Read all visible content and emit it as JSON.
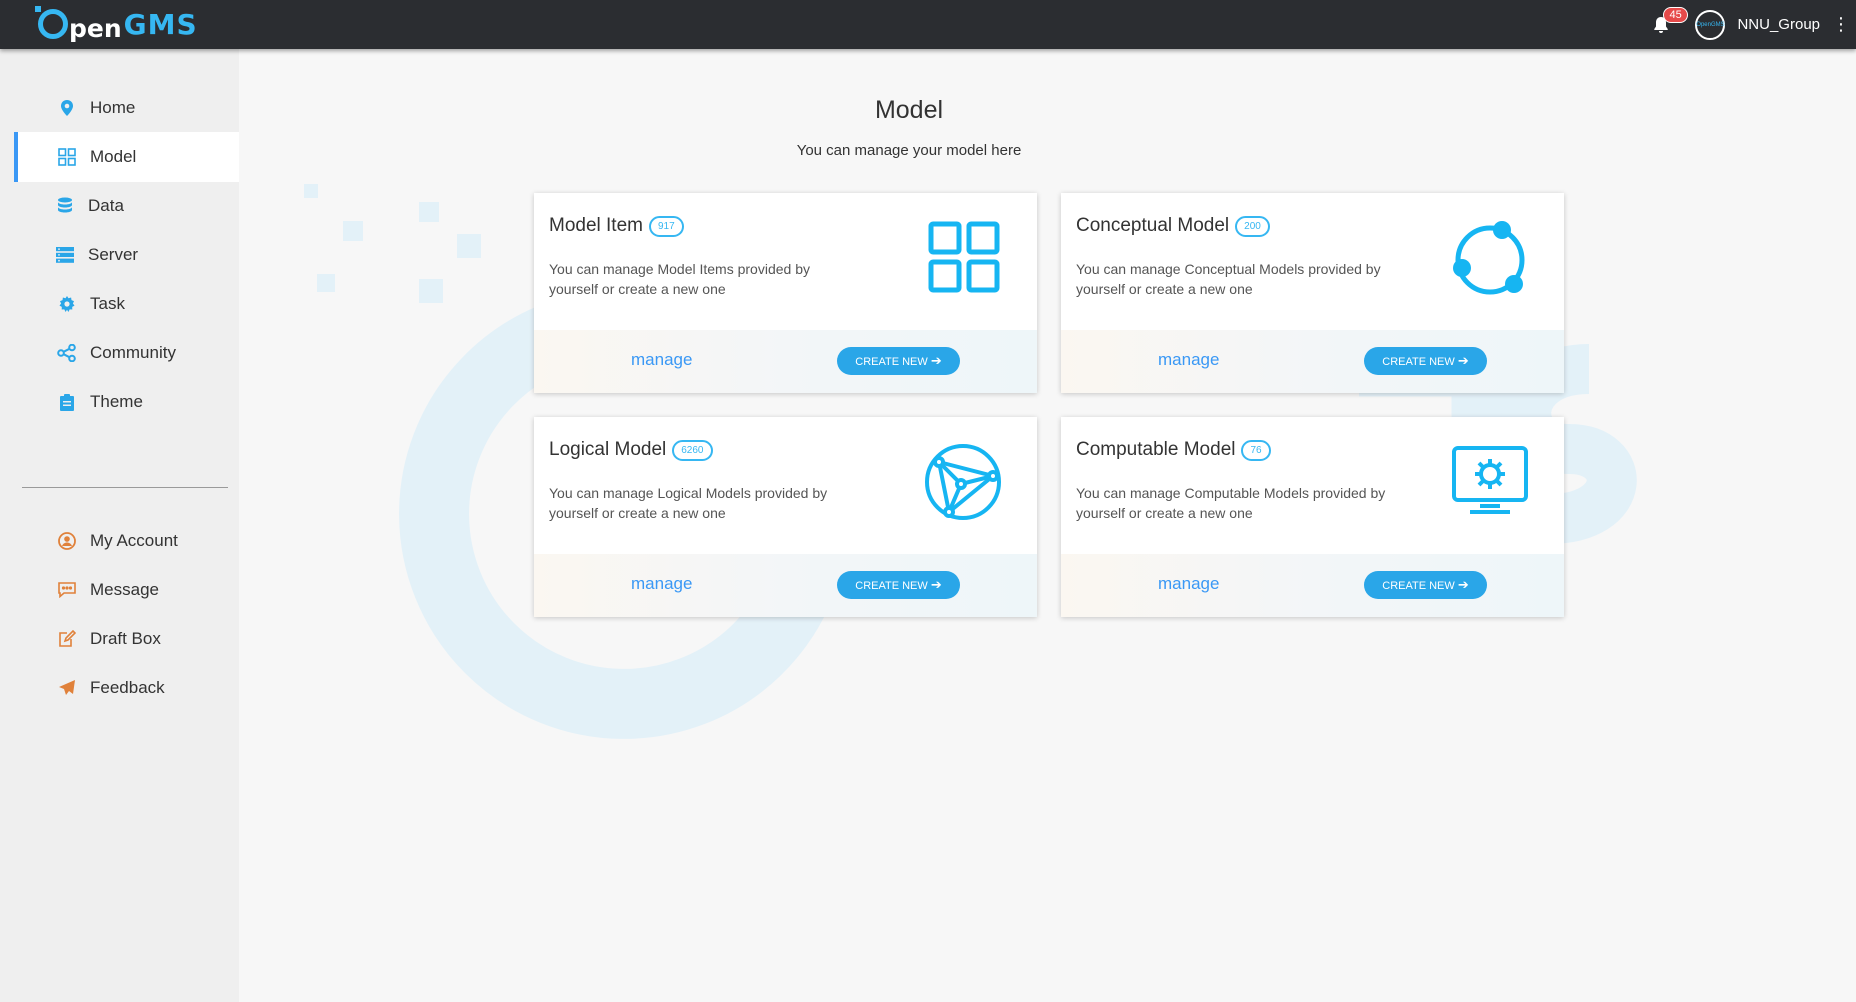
{
  "header": {
    "logo": {
      "pen": "pen",
      "gms": "GMS"
    },
    "notification_count": "45",
    "avatar_text": "OpenGMS",
    "username": "NNU_Group",
    "more_icon": "⋮"
  },
  "sidebar": {
    "items": [
      {
        "label": "Home",
        "icon": "location-pin-icon"
      },
      {
        "label": "Model",
        "icon": "grid-icon",
        "active": true
      },
      {
        "label": "Data",
        "icon": "database-icon"
      },
      {
        "label": "Server",
        "icon": "server-icon"
      },
      {
        "label": "Task",
        "icon": "gear-icon"
      },
      {
        "label": "Community",
        "icon": "share-nodes-icon"
      },
      {
        "label": "Theme",
        "icon": "clipboard-icon"
      },
      {
        "label": "My Account",
        "icon": "user-icon"
      },
      {
        "label": "Message",
        "icon": "message-icon"
      },
      {
        "label": "Draft Box",
        "icon": "edit-icon"
      },
      {
        "label": "Feedback",
        "icon": "paper-plane-icon"
      }
    ]
  },
  "main": {
    "title": "Model",
    "subtitle": "You can manage your model here",
    "cards": [
      {
        "title": "Model Item",
        "count": "917",
        "desc": "You can manage Model Items provided by yourself or create a new one",
        "manage": "manage",
        "create": "CREATE NEW",
        "icon": "grid-icon"
      },
      {
        "title": "Conceptual Model",
        "count": "200",
        "desc": "You can manage Conceptual Models provided by yourself or create a new one",
        "manage": "manage",
        "create": "CREATE NEW",
        "icon": "cycle-icon"
      },
      {
        "title": "Logical Model",
        "count": "6260",
        "desc": "You can manage Logical Models provided by yourself or create a new one",
        "manage": "manage",
        "create": "CREATE NEW",
        "icon": "network-icon"
      },
      {
        "title": "Computable Model",
        "count": "76",
        "desc": "You can manage Computable Models provided by yourself or create a new one",
        "manage": "manage",
        "create": "CREATE NEW",
        "icon": "monitor-gear-icon"
      }
    ]
  },
  "colors": {
    "accent": "#36b7f2",
    "link": "#3a98f5",
    "topbar": "#2b2d31",
    "sidebar": "#efefef"
  }
}
